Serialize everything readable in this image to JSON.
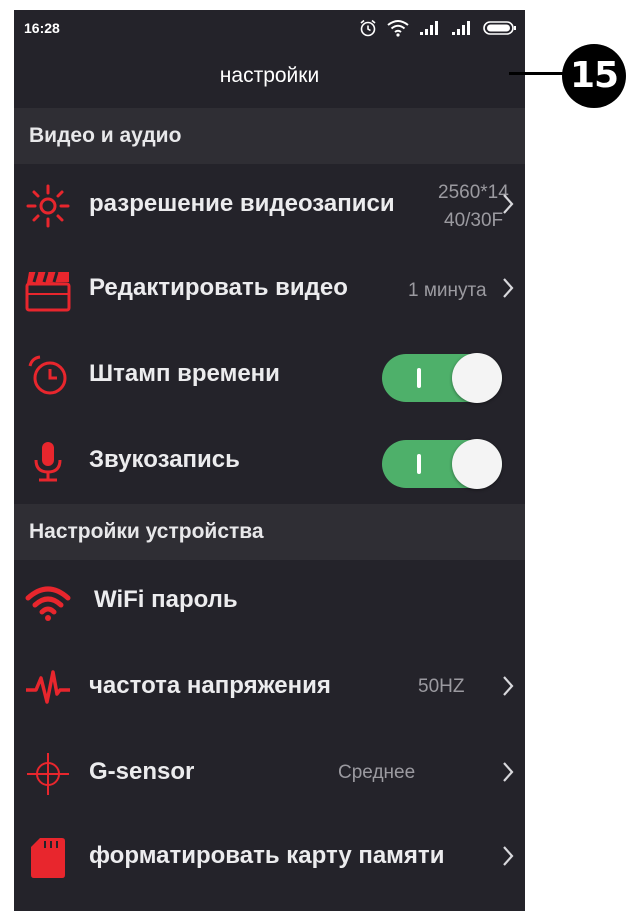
{
  "status_bar": {
    "time": "16:28",
    "icons": [
      "alarm-icon",
      "wifi-icon",
      "signal-icon",
      "signal-icon",
      "battery-icon"
    ]
  },
  "header": {
    "title": "настройки"
  },
  "callout": {
    "number": "15"
  },
  "sections": {
    "video_audio": {
      "title": "Видео и аудио",
      "items": [
        {
          "icon": "exposure-icon",
          "label": "разрешение видеозаписи",
          "value_line1": "2560*14",
          "value_line2": "40/30F",
          "has_chevron": true
        },
        {
          "icon": "clapperboard-icon",
          "label": "Редактировать видео",
          "value": "1 минута",
          "has_chevron": true
        },
        {
          "icon": "alarm-clock-icon",
          "label": "Штамп времени",
          "toggle": true
        },
        {
          "icon": "microphone-icon",
          "label": "Звукозапись",
          "toggle": true
        }
      ]
    },
    "device": {
      "title": "Настройки устройства",
      "items": [
        {
          "icon": "wifi-icon",
          "label": "WiFi пароль"
        },
        {
          "icon": "pulse-icon",
          "label": "частота напряжения",
          "value": "50HZ",
          "has_chevron": true
        },
        {
          "icon": "crosshair-icon",
          "label": "G-sensor",
          "value": "Среднее",
          "has_chevron": true
        },
        {
          "icon": "sd-card-icon",
          "label": "форматировать карту памяти",
          "has_chevron": true
        }
      ]
    }
  },
  "colors": {
    "background": "#24232a",
    "section_header": "#2f2e34",
    "accent_red": "#e8262d",
    "toggle_on": "#4eb06a"
  }
}
